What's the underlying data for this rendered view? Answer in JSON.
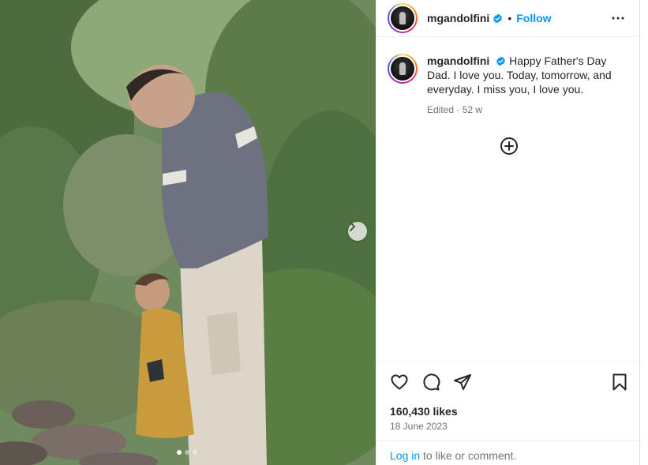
{
  "post": {
    "username": "mgandolfini",
    "follow_label": "Follow",
    "separator": "•",
    "caption": "Happy Father's Day Dad. I love you. Today, tomorrow, and everyday. I miss you, I love you.",
    "edited": "Edited",
    "meta_separator": "·",
    "age": "52 w",
    "likes": "160,430 likes",
    "date": "18 June 2023"
  },
  "footer": {
    "login_link": "Log in",
    "login_rest": " to like or comment."
  },
  "carousel": {
    "slide_count": 3,
    "current_slide": 1
  },
  "icons": {
    "verified": "verified-badge-icon",
    "more": "more-options-icon",
    "add": "add-circle-icon",
    "like": "heart-icon",
    "comment": "comment-icon",
    "share": "share-icon",
    "save": "bookmark-icon",
    "next": "chevron-right-icon"
  },
  "colors": {
    "link": "#0095f6",
    "text": "#262626",
    "secondary": "#737373"
  }
}
